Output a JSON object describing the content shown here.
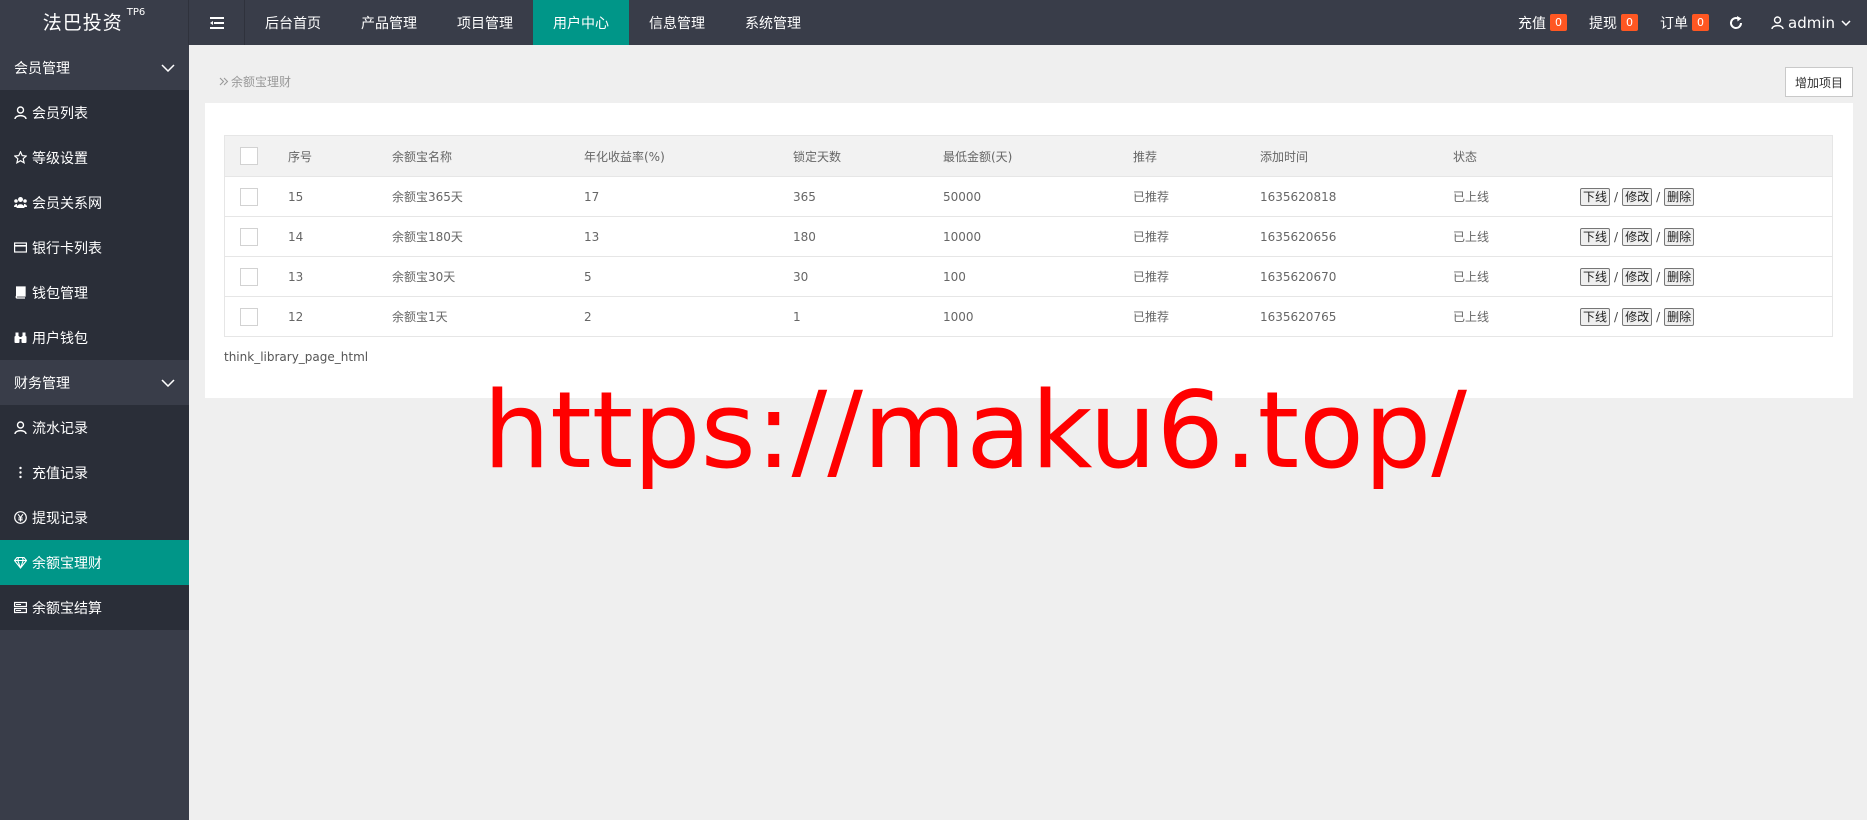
{
  "app": {
    "name": "法巴投资",
    "sup": "TP6"
  },
  "nav": [
    {
      "label": "后台首页",
      "active": false
    },
    {
      "label": "产品管理",
      "active": false
    },
    {
      "label": "项目管理",
      "active": false
    },
    {
      "label": "用户中心",
      "active": true
    },
    {
      "label": "信息管理",
      "active": false
    },
    {
      "label": "系统管理",
      "active": false
    }
  ],
  "topright": {
    "recharge": {
      "label": "充值",
      "count": "0"
    },
    "withdraw": {
      "label": "提现",
      "count": "0"
    },
    "order": {
      "label": "订单",
      "count": "0"
    },
    "user": "admin"
  },
  "sidebar": {
    "groups": [
      {
        "title": "会员管理",
        "items": [
          {
            "label": "会员列表",
            "icon": "user-icon"
          },
          {
            "label": "等级设置",
            "icon": "star-icon"
          },
          {
            "label": "会员关系网",
            "icon": "users-icon"
          },
          {
            "label": "银行卡列表",
            "icon": "card-icon"
          },
          {
            "label": "钱包管理",
            "icon": "book-icon"
          },
          {
            "label": "用户钱包",
            "icon": "binoculars-icon"
          }
        ]
      },
      {
        "title": "财务管理",
        "items": [
          {
            "label": "流水记录",
            "icon": "user-icon"
          },
          {
            "label": "充值记录",
            "icon": "more-vertical-icon"
          },
          {
            "label": "提现记录",
            "icon": "yen-circle-icon"
          },
          {
            "label": "余额宝理财",
            "icon": "diamond-icon",
            "active": true
          },
          {
            "label": "余额宝结算",
            "icon": "server-icon"
          }
        ]
      }
    ]
  },
  "content": {
    "breadcrumb": "余额宝理财",
    "add_button": "增加项目",
    "table": {
      "headers": [
        "序号",
        "余额宝名称",
        "年化收益率(%)",
        "锁定天数",
        "最低金额(天)",
        "推荐",
        "添加时间",
        "状态"
      ],
      "rows": [
        [
          "15",
          "余额宝365天",
          "17",
          "365",
          "50000",
          "已推荐",
          "1635620818",
          "已上线"
        ],
        [
          "14",
          "余额宝180天",
          "13",
          "180",
          "10000",
          "已推荐",
          "1635620656",
          "已上线"
        ],
        [
          "13",
          "余额宝30天",
          "5",
          "30",
          "100",
          "已推荐",
          "1635620670",
          "已上线"
        ],
        [
          "12",
          "余额宝1天",
          "2",
          "1",
          "1000",
          "已推荐",
          "1635620765",
          "已上线"
        ]
      ],
      "actions": {
        "offline": "下线",
        "edit": "修改",
        "delete": "删除",
        "sep": "/"
      }
    },
    "page_html": "think_library_page_html"
  },
  "watermark": "https://maku6.top/",
  "colors": {
    "accent": "#009688",
    "topbar": "#393d49",
    "sidebar_item": "#2a2e38",
    "badge": "#ff5722",
    "watermark": "#ff0000"
  }
}
